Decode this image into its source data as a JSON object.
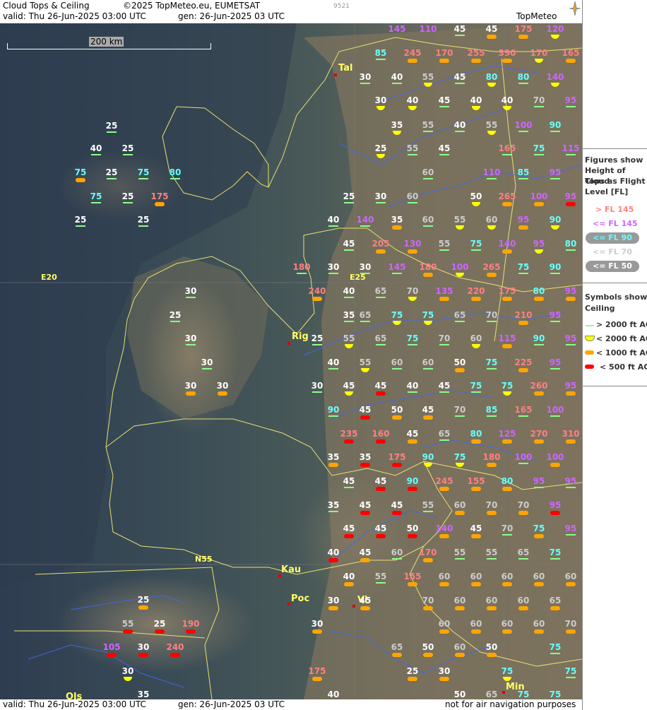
{
  "header": {
    "title": "Cloud Tops & Ceiling",
    "copyright": "©2025 TopMeteo.eu, EUMETSAT",
    "valid": "valid:  Thu  26-Jun-2025  03:00 UTC",
    "gen": "gen: 26-Jun-2025 03 UTC",
    "code": "9521",
    "logo": "TopMeteo"
  },
  "footer": {
    "valid": "valid:  Thu  26-Jun-2025  03:00 UTC",
    "gen": "gen: 26-Jun-2025 03 UTC",
    "note": "not for air navigation purposes"
  },
  "scale_label": "200 km",
  "legend": {
    "figures_title": [
      "Figures show",
      "Height of Cloud",
      "Tops as Flight",
      "Level  [FL]"
    ],
    "fl_items": [
      {
        "text": "> FL 145",
        "color": "#ff8080"
      },
      {
        "text": "<= FL 145",
        "color": "#cc66ff"
      },
      {
        "text": "<= FL 90",
        "color": "#66ffff"
      },
      {
        "text": "<= FL 70",
        "color": "#cccccc"
      },
      {
        "text": "<= FL 50",
        "color": "#ffffff"
      }
    ],
    "symbols_title": [
      "Symbols show",
      "Ceiling"
    ],
    "ceiling_items": [
      {
        "text": "> 2000 ft AGL",
        "color": "#88ff88",
        "shape": "line"
      },
      {
        "text": "< 2000 ft AGL",
        "color": "#ffff00",
        "shape": "half"
      },
      {
        "text": "< 1000 ft AGL",
        "color": "#ffa500",
        "shape": "bar"
      },
      {
        "text": "< 500 ft AGL",
        "color": "#ff0000",
        "shape": "bar"
      }
    ]
  },
  "cities": [
    {
      "name": "Tal"
    },
    {
      "name": "Rig"
    },
    {
      "name": "Kau"
    },
    {
      "name": "Poc"
    },
    {
      "name": "Vi"
    },
    {
      "name": "Min"
    },
    {
      "name": "Ols"
    }
  ],
  "roads": [
    "E20",
    "E25",
    "N55"
  ],
  "observations": [
    {
      "v": 145,
      "s": "none"
    },
    {
      "v": 110,
      "s": "none"
    },
    {
      "v": 45,
      "s": "line"
    },
    {
      "v": 45,
      "s": "orange"
    },
    {
      "v": 175,
      "s": "orange"
    },
    {
      "v": 120,
      "s": "yellow"
    },
    {
      "v": 85,
      "s": "line"
    },
    {
      "v": 245,
      "s": "orange"
    },
    {
      "v": 170,
      "s": "orange"
    },
    {
      "v": 255,
      "s": "orange"
    },
    {
      "v": 390,
      "s": "orange"
    },
    {
      "v": 170,
      "s": "yellow"
    },
    {
      "v": 165,
      "s": "orange"
    },
    {
      "v": 30,
      "s": "line"
    },
    {
      "v": 40,
      "s": "line"
    },
    {
      "v": 55,
      "s": "yellow"
    },
    {
      "v": 45,
      "s": "line"
    },
    {
      "v": 80,
      "s": "yellow"
    },
    {
      "v": 80,
      "s": "line"
    },
    {
      "v": 140,
      "s": "yellow"
    },
    {
      "v": 30,
      "s": "yellow"
    },
    {
      "v": 40,
      "s": "yellow"
    },
    {
      "v": 45,
      "s": "line"
    },
    {
      "v": 40,
      "s": "yellow"
    },
    {
      "v": 40,
      "s": "yellow"
    },
    {
      "v": 70,
      "s": "line"
    },
    {
      "v": 95,
      "s": "line"
    },
    {
      "v": 35,
      "s": "yellow"
    },
    {
      "v": 55,
      "s": "line"
    },
    {
      "v": 40,
      "s": "line"
    },
    {
      "v": 55,
      "s": "yellow"
    },
    {
      "v": 100,
      "s": "line"
    },
    {
      "v": 90,
      "s": "line"
    },
    {
      "v": 25,
      "s": "yellow"
    },
    {
      "v": 55,
      "s": "line"
    },
    {
      "v": 45,
      "s": "line"
    },
    {
      "v": 165,
      "s": "line"
    },
    {
      "v": 75,
      "s": "line"
    },
    {
      "v": 115,
      "s": "line"
    },
    {
      "v": 60,
      "s": "line"
    },
    {
      "v": 110,
      "s": "line"
    },
    {
      "v": 85,
      "s": "line"
    },
    {
      "v": 95,
      "s": "line"
    },
    {
      "v": 25,
      "s": "line"
    },
    {
      "v": 30,
      "s": "line"
    },
    {
      "v": 60,
      "s": "line"
    },
    {
      "v": 50,
      "s": "yellow"
    },
    {
      "v": 265,
      "s": "orange"
    },
    {
      "v": 100,
      "s": "orange"
    },
    {
      "v": 95,
      "s": "red"
    },
    {
      "v": 40,
      "s": "line"
    },
    {
      "v": 140,
      "s": "line"
    },
    {
      "v": 35,
      "s": "orange"
    },
    {
      "v": 60,
      "s": "line"
    },
    {
      "v": 55,
      "s": "yellow"
    },
    {
      "v": 60,
      "s": "yellow"
    },
    {
      "v": 95,
      "s": "orange"
    },
    {
      "v": 90,
      "s": "yellow"
    },
    {
      "v": 45,
      "s": "line"
    },
    {
      "v": 205,
      "s": "orange"
    },
    {
      "v": 130,
      "s": "orange"
    },
    {
      "v": 55,
      "s": "line"
    },
    {
      "v": 75,
      "s": "line"
    },
    {
      "v": 140,
      "s": "orange"
    },
    {
      "v": 95,
      "s": "yellow"
    },
    {
      "v": 80,
      "s": "line"
    },
    {
      "v": 180,
      "s": "line"
    },
    {
      "v": 30,
      "s": "line"
    },
    {
      "v": 30,
      "s": "line"
    },
    {
      "v": 145,
      "s": "line"
    },
    {
      "v": 180,
      "s": "orange"
    },
    {
      "v": 100,
      "s": "yellow"
    },
    {
      "v": 265,
      "s": "orange"
    },
    {
      "v": 75,
      "s": "line"
    },
    {
      "v": 90,
      "s": "line"
    },
    {
      "v": 240,
      "s": "orange"
    },
    {
      "v": 40,
      "s": "line"
    },
    {
      "v": 65,
      "s": "line"
    },
    {
      "v": 70,
      "s": "yellow"
    },
    {
      "v": 135,
      "s": "orange"
    },
    {
      "v": 220,
      "s": "orange"
    },
    {
      "v": 175,
      "s": "orange"
    },
    {
      "v": 80,
      "s": "orange"
    },
    {
      "v": 95,
      "s": "orange"
    },
    {
      "v": 35,
      "s": "line"
    },
    {
      "v": 65,
      "s": "line"
    },
    {
      "v": 75,
      "s": "yellow"
    },
    {
      "v": 75,
      "s": "yellow"
    },
    {
      "v": 65,
      "s": "line"
    },
    {
      "v": 70,
      "s": "line"
    },
    {
      "v": 210,
      "s": "orange"
    },
    {
      "v": 95,
      "s": "line"
    },
    {
      "v": 25,
      "s": "line"
    },
    {
      "v": 55,
      "s": "yellow"
    },
    {
      "v": 65,
      "s": "line"
    },
    {
      "v": 75,
      "s": "line"
    },
    {
      "v": 70,
      "s": "line"
    },
    {
      "v": 60,
      "s": "yellow"
    },
    {
      "v": 115,
      "s": "orange"
    },
    {
      "v": 90,
      "s": "line"
    },
    {
      "v": 95,
      "s": "line"
    },
    {
      "v": 40,
      "s": "line"
    },
    {
      "v": 55,
      "s": "yellow"
    },
    {
      "v": 60,
      "s": "line"
    },
    {
      "v": 60,
      "s": "line"
    },
    {
      "v": 50,
      "s": "orange"
    },
    {
      "v": 75,
      "s": "line"
    },
    {
      "v": 225,
      "s": "orange"
    },
    {
      "v": 95,
      "s": "line"
    },
    {
      "v": 30,
      "s": "line"
    },
    {
      "v": 45,
      "s": "yellow"
    },
    {
      "v": 45,
      "s": "red"
    },
    {
      "v": 40,
      "s": "line"
    },
    {
      "v": 45,
      "s": "line"
    },
    {
      "v": 75,
      "s": "line"
    },
    {
      "v": 75,
      "s": "yellow"
    },
    {
      "v": 260,
      "s": "orange"
    },
    {
      "v": 95,
      "s": "orange"
    },
    {
      "v": 90,
      "s": "line"
    },
    {
      "v": 45,
      "s": "red"
    },
    {
      "v": 50,
      "s": "orange"
    },
    {
      "v": 45,
      "s": "orange"
    },
    {
      "v": 70,
      "s": "line"
    },
    {
      "v": 85,
      "s": "line"
    },
    {
      "v": 165,
      "s": "line"
    },
    {
      "v": 100,
      "s": "line"
    },
    {
      "v": 235,
      "s": "red"
    },
    {
      "v": 160,
      "s": "red"
    },
    {
      "v": 45,
      "s": "orange"
    },
    {
      "v": 65,
      "s": "line"
    },
    {
      "v": 80,
      "s": "orange"
    },
    {
      "v": 125,
      "s": "orange"
    },
    {
      "v": 270,
      "s": "orange"
    },
    {
      "v": 310,
      "s": "orange"
    },
    {
      "v": 35,
      "s": "orange"
    },
    {
      "v": 35,
      "s": "red"
    },
    {
      "v": 175,
      "s": "red"
    },
    {
      "v": 90,
      "s": "yellow"
    },
    {
      "v": 75,
      "s": "yellow"
    },
    {
      "v": 180,
      "s": "orange"
    },
    {
      "v": 100,
      "s": "line"
    },
    {
      "v": 100,
      "s": "orange"
    },
    {
      "v": 45,
      "s": "line"
    },
    {
      "v": 45,
      "s": "red"
    },
    {
      "v": 90,
      "s": "red"
    },
    {
      "v": 245,
      "s": "orange"
    },
    {
      "v": 155,
      "s": "orange"
    },
    {
      "v": 80,
      "s": "orange"
    },
    {
      "v": 95,
      "s": "line"
    },
    {
      "v": 95,
      "s": "line"
    },
    {
      "v": 35,
      "s": "line"
    },
    {
      "v": 45,
      "s": "red"
    },
    {
      "v": 45,
      "s": "red"
    },
    {
      "v": 55,
      "s": "line"
    },
    {
      "v": 60,
      "s": "orange"
    },
    {
      "v": 70,
      "s": "orange"
    },
    {
      "v": 70,
      "s": "orange"
    },
    {
      "v": 95,
      "s": "red"
    },
    {
      "v": 45,
      "s": "red"
    },
    {
      "v": 45,
      "s": "red"
    },
    {
      "v": 50,
      "s": "red"
    },
    {
      "v": 140,
      "s": "orange"
    },
    {
      "v": 45,
      "s": "orange"
    },
    {
      "v": 70,
      "s": "line"
    },
    {
      "v": 75,
      "s": "orange"
    },
    {
      "v": 95,
      "s": "line"
    },
    {
      "v": 40,
      "s": "red"
    },
    {
      "v": 45,
      "s": "orange"
    },
    {
      "v": 60,
      "s": "line"
    },
    {
      "v": 170,
      "s": "orange"
    },
    {
      "v": 55,
      "s": "line"
    },
    {
      "v": 55,
      "s": "line"
    },
    {
      "v": 65,
      "s": "line"
    },
    {
      "v": 75,
      "s": "line"
    },
    {
      "v": 40,
      "s": "orange"
    },
    {
      "v": 55,
      "s": "line"
    },
    {
      "v": 155,
      "s": "orange"
    },
    {
      "v": 60,
      "s": "orange"
    },
    {
      "v": 60,
      "s": "orange"
    },
    {
      "v": 60,
      "s": "orange"
    },
    {
      "v": 60,
      "s": "orange"
    },
    {
      "v": 60,
      "s": "orange"
    },
    {
      "v": 30,
      "s": "orange"
    },
    {
      "v": 45,
      "s": "orange"
    },
    {
      "v": 70,
      "s": "orange"
    },
    {
      "v": 60,
      "s": "orange"
    },
    {
      "v": 60,
      "s": "orange"
    },
    {
      "v": 60,
      "s": "orange"
    },
    {
      "v": 65,
      "s": "orange"
    },
    {
      "v": 30,
      "s": "orange"
    },
    {
      "v": 60,
      "s": "orange"
    },
    {
      "v": 60,
      "s": "orange"
    },
    {
      "v": 60,
      "s": "orange"
    },
    {
      "v": 60,
      "s": "orange"
    },
    {
      "v": 70,
      "s": "orange"
    },
    {
      "v": 65,
      "s": "orange"
    },
    {
      "v": 50,
      "s": "orange"
    },
    {
      "v": 60,
      "s": "orange"
    },
    {
      "v": 50,
      "s": "orange"
    },
    {
      "v": 75,
      "s": "line"
    },
    {
      "v": 25,
      "s": "orange"
    },
    {
      "v": 30,
      "s": "orange"
    },
    {
      "v": 75,
      "s": "yellow"
    },
    {
      "v": 75,
      "s": "line"
    },
    {
      "v": 175,
      "s": "orange"
    },
    {
      "v": 40,
      "s": "none"
    },
    {
      "v": 50,
      "s": "none"
    },
    {
      "v": 65,
      "s": "none"
    },
    {
      "v": 75,
      "s": "none"
    },
    {
      "v": 75,
      "s": "none"
    },
    {
      "v": 25,
      "s": "line"
    },
    {
      "v": 40,
      "s": "line"
    },
    {
      "v": 25,
      "s": "line"
    },
    {
      "v": 75,
      "s": "orange"
    },
    {
      "v": 25,
      "s": "line"
    },
    {
      "v": 75,
      "s": "line"
    },
    {
      "v": 80,
      "s": "line"
    },
    {
      "v": 75,
      "s": "line"
    },
    {
      "v": 25,
      "s": "line"
    },
    {
      "v": 175,
      "s": "orange"
    },
    {
      "v": 25,
      "s": "line"
    },
    {
      "v": 25,
      "s": "line"
    },
    {
      "v": 30,
      "s": "line"
    },
    {
      "v": 25,
      "s": "line"
    },
    {
      "v": 30,
      "s": "line"
    },
    {
      "v": 30,
      "s": "line"
    },
    {
      "v": 30,
      "s": "orange"
    },
    {
      "v": 30,
      "s": "orange"
    },
    {
      "v": 25,
      "s": "orange"
    },
    {
      "v": 55,
      "s": "red"
    },
    {
      "v": 25,
      "s": "red"
    },
    {
      "v": 190,
      "s": "red"
    },
    {
      "v": 105,
      "s": "red"
    },
    {
      "v": 30,
      "s": "red"
    },
    {
      "v": 240,
      "s": "red"
    },
    {
      "v": 30,
      "s": "yellow"
    },
    {
      "v": 35,
      "s": "none"
    }
  ]
}
